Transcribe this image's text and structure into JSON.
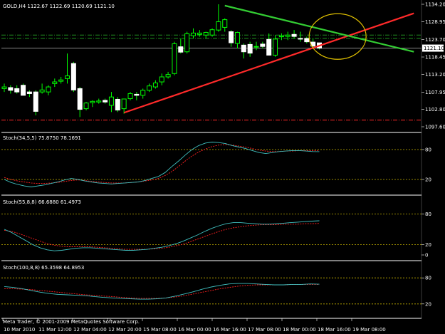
{
  "chart_data": {
    "type": "candlestick",
    "title": "GOLD,H4  1122.67 1122.69 1120.69 1121.10",
    "symbol": "GOLD",
    "timeframe": "H4",
    "header_ohlc": {
      "open": 1122.67,
      "high": 1122.69,
      "low": 1120.69,
      "close": 1121.1
    },
    "current_price_label": "1121.10",
    "price_axis": {
      "ticks": [
        "1134.20",
        "1128.95",
        "1123.70",
        "1118.45",
        "1113.20",
        "1107.95",
        "1102.80",
        "1097.60"
      ],
      "ylim": [
        1097.6,
        1134.2
      ]
    },
    "time_axis": {
      "ticks": [
        "10 Mar 2010",
        "11 Mar 12:00",
        "12 Mar 04:00",
        "12 Mar 20:00",
        "15 Mar 08:00",
        "16 Mar 00:00",
        "16 Mar 16:00",
        "17 Mar 08:00",
        "18 Mar 00:00",
        "18 Mar 16:00",
        "19 Mar 08:00"
      ]
    },
    "candles": [
      {
        "o": 1109.0,
        "h": 1110.5,
        "l": 1108.0,
        "c": 1109.5
      },
      {
        "o": 1109.3,
        "h": 1110.0,
        "l": 1107.5,
        "c": 1108.5
      },
      {
        "o": 1109.0,
        "h": 1110.0,
        "l": 1107.5,
        "c": 1108.0
      },
      {
        "o": 1110.0,
        "h": 1110.5,
        "l": 1107.0,
        "c": 1107.0
      },
      {
        "o": 1108.0,
        "h": 1108.5,
        "l": 1106.5,
        "c": 1107.5
      },
      {
        "o": 1108.0,
        "h": 1108.5,
        "l": 1101.0,
        "c": 1102.2
      },
      {
        "o": 1108.0,
        "h": 1110.5,
        "l": 1107.5,
        "c": 1108.6
      },
      {
        "o": 1108.0,
        "h": 1110.0,
        "l": 1107.0,
        "c": 1109.5
      },
      {
        "o": 1110.5,
        "h": 1112.0,
        "l": 1109.5,
        "c": 1111.0
      },
      {
        "o": 1111.2,
        "h": 1112.5,
        "l": 1110.5,
        "c": 1111.6
      },
      {
        "o": 1112.0,
        "h": 1119.5,
        "l": 1110.5,
        "c": 1112.8
      },
      {
        "o": 1116.5,
        "h": 1117.0,
        "l": 1108.0,
        "c": 1108.6
      },
      {
        "o": 1109.0,
        "h": 1109.5,
        "l": 1100.5,
        "c": 1102.8
      },
      {
        "o": 1103.0,
        "h": 1105.0,
        "l": 1102.5,
        "c": 1104.7
      },
      {
        "o": 1104.8,
        "h": 1105.5,
        "l": 1103.5,
        "c": 1105.2
      },
      {
        "o": 1105.0,
        "h": 1106.0,
        "l": 1104.5,
        "c": 1105.3
      },
      {
        "o": 1105.5,
        "h": 1106.0,
        "l": 1104.5,
        "c": 1105.0
      },
      {
        "o": 1104.0,
        "h": 1108.0,
        "l": 1102.0,
        "c": 1106.5
      },
      {
        "o": 1105.8,
        "h": 1106.5,
        "l": 1102.0,
        "c": 1102.6
      },
      {
        "o": 1103.0,
        "h": 1106.0,
        "l": 1101.5,
        "c": 1105.9
      },
      {
        "o": 1106.0,
        "h": 1108.0,
        "l": 1105.5,
        "c": 1107.5
      },
      {
        "o": 1107.3,
        "h": 1108.0,
        "l": 1105.5,
        "c": 1107.0
      },
      {
        "o": 1107.0,
        "h": 1109.0,
        "l": 1106.0,
        "c": 1108.5
      },
      {
        "o": 1108.5,
        "h": 1110.5,
        "l": 1108.0,
        "c": 1109.8
      },
      {
        "o": 1109.5,
        "h": 1111.5,
        "l": 1109.0,
        "c": 1110.7
      },
      {
        "o": 1111.0,
        "h": 1113.5,
        "l": 1110.0,
        "c": 1112.5
      },
      {
        "o": 1112.5,
        "h": 1114.0,
        "l": 1112.0,
        "c": 1113.2
      },
      {
        "o": 1113.5,
        "h": 1123.0,
        "l": 1113.0,
        "c": 1122.4
      },
      {
        "o": 1121.5,
        "h": 1124.0,
        "l": 1119.5,
        "c": 1119.9
      },
      {
        "o": 1120.0,
        "h": 1126.0,
        "l": 1119.5,
        "c": 1125.4
      },
      {
        "o": 1124.8,
        "h": 1127.0,
        "l": 1124.0,
        "c": 1125.6
      },
      {
        "o": 1125.2,
        "h": 1126.5,
        "l": 1124.5,
        "c": 1125.6
      },
      {
        "o": 1125.0,
        "h": 1126.0,
        "l": 1124.0,
        "c": 1125.8
      },
      {
        "o": 1125.0,
        "h": 1127.0,
        "l": 1124.5,
        "c": 1126.6
      },
      {
        "o": 1126.5,
        "h": 1134.2,
        "l": 1126.0,
        "c": 1129.0
      },
      {
        "o": 1127.3,
        "h": 1130.0,
        "l": 1126.0,
        "c": 1129.6
      },
      {
        "o": 1126.0,
        "h": 1126.5,
        "l": 1121.5,
        "c": 1122.7
      },
      {
        "o": 1122.5,
        "h": 1126.0,
        "l": 1121.0,
        "c": 1125.8
      },
      {
        "o": 1122.0,
        "h": 1122.5,
        "l": 1118.0,
        "c": 1120.0
      },
      {
        "o": 1122.2,
        "h": 1123.0,
        "l": 1118.5,
        "c": 1119.6
      },
      {
        "o": 1121.5,
        "h": 1123.0,
        "l": 1120.5,
        "c": 1121.6
      },
      {
        "o": 1122.3,
        "h": 1123.0,
        "l": 1121.0,
        "c": 1121.6
      },
      {
        "o": 1123.7,
        "h": 1125.5,
        "l": 1119.0,
        "c": 1119.0
      },
      {
        "o": 1119.0,
        "h": 1125.0,
        "l": 1118.5,
        "c": 1123.8
      },
      {
        "o": 1124.5,
        "h": 1125.5,
        "l": 1123.5,
        "c": 1124.8
      },
      {
        "o": 1124.6,
        "h": 1126.0,
        "l": 1123.5,
        "c": 1125.0
      },
      {
        "o": 1125.2,
        "h": 1126.5,
        "l": 1124.0,
        "c": 1124.6
      },
      {
        "o": 1124.0,
        "h": 1126.0,
        "l": 1123.0,
        "c": 1123.9
      },
      {
        "o": 1124.0,
        "h": 1124.5,
        "l": 1122.5,
        "c": 1123.0
      },
      {
        "o": 1122.9,
        "h": 1124.0,
        "l": 1121.0,
        "c": 1121.7
      },
      {
        "o": 1122.67,
        "h": 1122.69,
        "l": 1120.69,
        "c": 1121.1
      }
    ],
    "trendlines": [
      {
        "name": "support",
        "color": "#ff2a2a",
        "from": {
          "candle": 19,
          "price": 1101.8
        },
        "to": {
          "candle": 65,
          "price": 1131.5
        }
      },
      {
        "name": "resistance",
        "color": "#33cc33",
        "from": {
          "candle": 35,
          "price": 1133.8
        },
        "to": {
          "candle": 65,
          "price": 1120.0
        }
      }
    ],
    "horizontal_lines": [
      {
        "price": 1125.0,
        "color": "#1f8f1f",
        "style": "dashdot"
      },
      {
        "price": 1124.0,
        "color": "#1f8f1f",
        "style": "dashdot"
      },
      {
        "price": 1121.1,
        "color": "#888888",
        "style": "solid"
      },
      {
        "price": 1099.6,
        "color": "#ff2a2a",
        "style": "dashdot"
      }
    ],
    "annotation_ellipse": {
      "center_candle": 52,
      "center_price": 1125.0,
      "color": "#e0c000"
    },
    "indicators": [
      {
        "title": "Stoch(34,5,5) 75.8750 78.1691",
        "levels": [
          80,
          20
        ],
        "ylim": [
          0,
          100
        ],
        "main": [
          20,
          14,
          10,
          7,
          5,
          7,
          9,
          12,
          15,
          19,
          22,
          20,
          17,
          15,
          13,
          12,
          11,
          12,
          13,
          14,
          15,
          18,
          22,
          26,
          34,
          46,
          57,
          69,
          80,
          88,
          93,
          95,
          94,
          92,
          88,
          85,
          82,
          78,
          74,
          72,
          74,
          76,
          77,
          78,
          78,
          77,
          76,
          75.9
        ],
        "signal": [
          24,
          20,
          17,
          15,
          13,
          12,
          12,
          13,
          14,
          16,
          18,
          19,
          18,
          16,
          15,
          14,
          13,
          13,
          13,
          14,
          15,
          17,
          19,
          22,
          28,
          36,
          46,
          57,
          67,
          75,
          81,
          86,
          89,
          90,
          89,
          87,
          85,
          82,
          79,
          77,
          76,
          76,
          77,
          77,
          78,
          78,
          78,
          78.2
        ]
      },
      {
        "title": "Stoch(55,8,8) 66.6880 61.4973",
        "levels": [
          80,
          20,
          0
        ],
        "ylim": [
          0,
          100
        ],
        "main": [
          50,
          44,
          36,
          28,
          20,
          14,
          10,
          8,
          9,
          11,
          13,
          14,
          14,
          13,
          12,
          11,
          10,
          9,
          9,
          10,
          11,
          13,
          15,
          18,
          22,
          27,
          33,
          39,
          46,
          52,
          57,
          61,
          63,
          63,
          62,
          61,
          60,
          60,
          61,
          62,
          63,
          64,
          65,
          66,
          66.7
        ],
        "signal": [
          48,
          46,
          42,
          37,
          32,
          27,
          22,
          19,
          17,
          16,
          16,
          16,
          16,
          15,
          14,
          13,
          12,
          11,
          11,
          11,
          11,
          12,
          13,
          15,
          18,
          21,
          26,
          31,
          36,
          41,
          46,
          50,
          53,
          55,
          57,
          58,
          59,
          59,
          59,
          60,
          60,
          60,
          61,
          61,
          61.5
        ]
      },
      {
        "title": "Stoch(100,8,8) 65.3598 64.8953",
        "levels": [
          80,
          20
        ],
        "ylim": [
          0,
          100
        ],
        "main": [
          60,
          58,
          55,
          51,
          47,
          44,
          42,
          41,
          40,
          39,
          37,
          35,
          34,
          33,
          32,
          31,
          31,
          32,
          34,
          38,
          43,
          48,
          54,
          59,
          63,
          66,
          67,
          67,
          66,
          65,
          64,
          64,
          65,
          65,
          66,
          65.4
        ],
        "signal": [
          55,
          55,
          54,
          53,
          51,
          49,
          47,
          45,
          43,
          41,
          40,
          38,
          37,
          35,
          34,
          33,
          33,
          33,
          34,
          36,
          39,
          43,
          47,
          51,
          55,
          58,
          61,
          63,
          64,
          64,
          64,
          64,
          65,
          65,
          65,
          64.9
        ]
      }
    ],
    "footer": "Meta Trader, © 2001-2009 MetaQuotes Software Corp.",
    "colors": {
      "background": "#000000",
      "bull_body": "#000000",
      "bear_body": "#ffffff",
      "bull_outline": "#00ff00",
      "wick": "#00ff00",
      "stoch_main": "#40c0c0",
      "stoch_signal": "#ff2020",
      "level_line": "#c8b400",
      "separator": "#ffffff"
    }
  }
}
